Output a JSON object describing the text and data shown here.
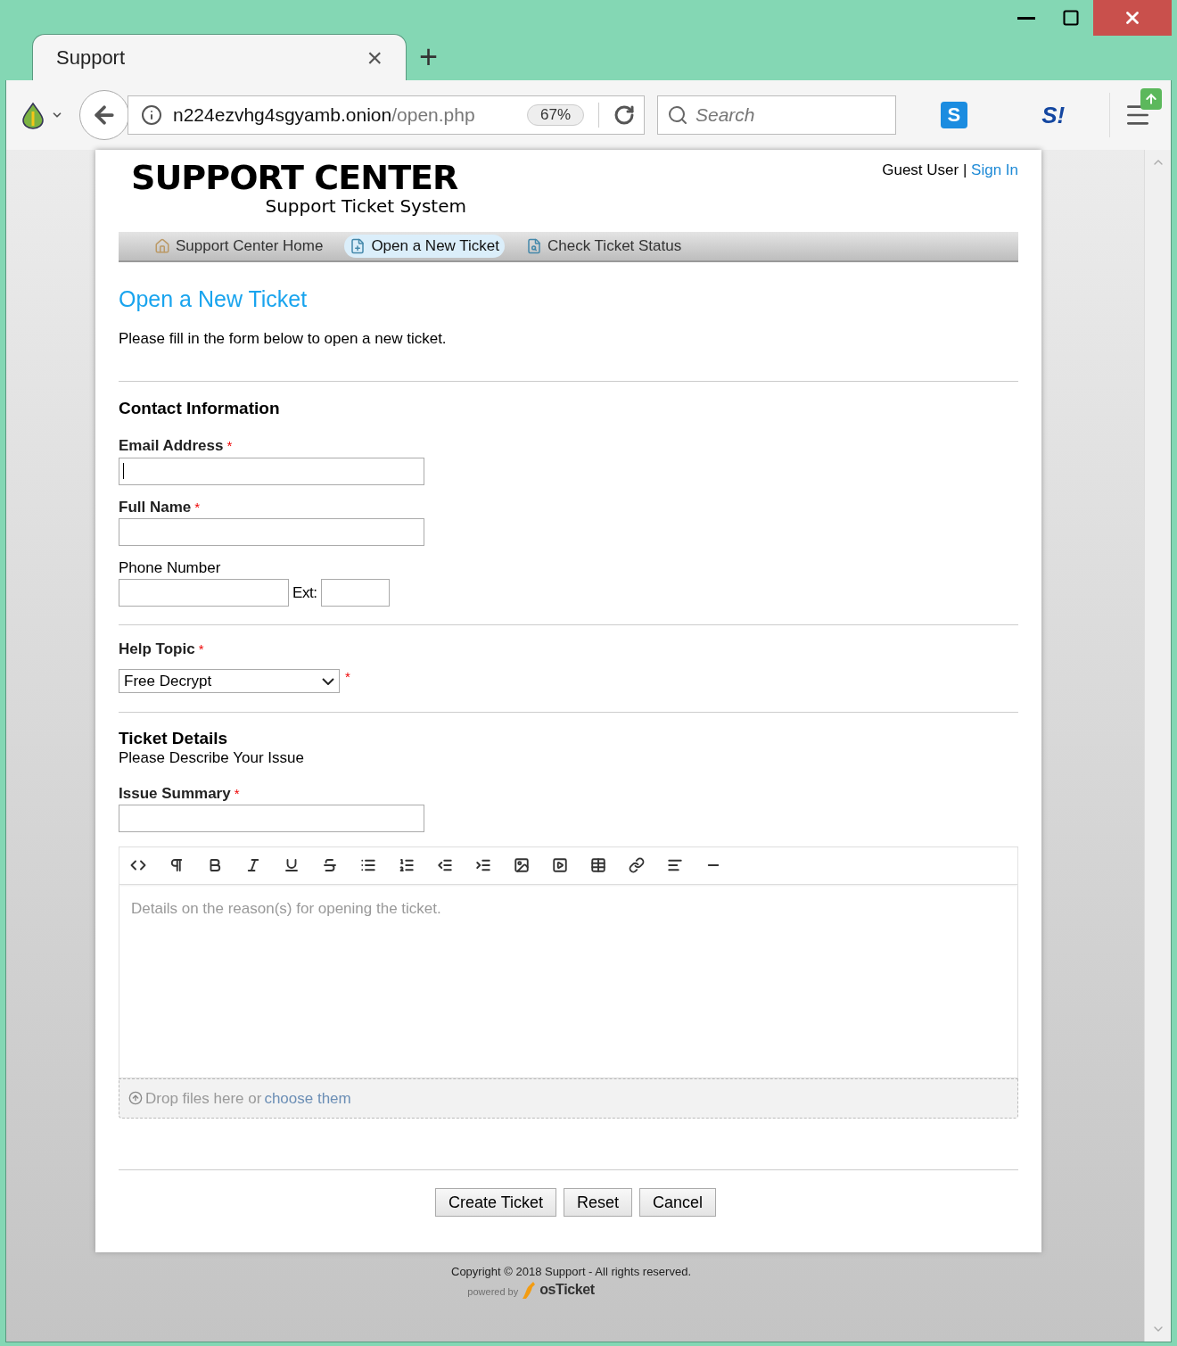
{
  "browser": {
    "tab": {
      "title": "Support",
      "close": "×"
    },
    "new_tab": "+",
    "url": {
      "host": "n224ezvhg4sgyamb.onion",
      "path": "/open.php"
    },
    "zoom": "67%",
    "search": {
      "placeholder": "Search"
    },
    "extension_icons": [
      "S",
      "S!"
    ]
  },
  "header": {
    "logo_title": "SUPPORT CENTER",
    "logo_subtitle": "Support Ticket System",
    "user": "Guest User |",
    "sign_in": "Sign In"
  },
  "nav": [
    {
      "label": "Support Center Home",
      "kind": "home",
      "selected": false
    },
    {
      "label": "Open a New Ticket",
      "kind": "new",
      "selected": true
    },
    {
      "label": "Check Ticket Status",
      "kind": "status",
      "selected": false
    }
  ],
  "page": {
    "title": "Open a New Ticket",
    "intro": "Please fill in the form below to open a new ticket."
  },
  "contact": {
    "heading": "Contact Information",
    "email": {
      "label": "Email Address",
      "required_mark": "*",
      "focused": true
    },
    "name": {
      "label": "Full Name",
      "required_mark": "*",
      "focused": false
    },
    "phone": {
      "label": "Phone Number",
      "ext_label": "Ext:"
    }
  },
  "help_topic": {
    "label": "Help Topic",
    "value": "Free Decrypt",
    "required_mark": "*"
  },
  "details": {
    "heading": "Ticket Details",
    "subheading": "Please Describe Your Issue",
    "summary": {
      "label": "Issue Summary",
      "required_mark": "*"
    },
    "editor": {
      "placeholder": "Details on the reason(s) for opening the ticket."
    },
    "dropzone": {
      "text": "Drop files here or",
      "link": "choose them"
    }
  },
  "buttons": [
    "Create Ticket",
    "Reset",
    "Cancel"
  ],
  "footer": {
    "copyright": "Copyright © 2018 Support - All rights reserved.",
    "powered_by": "powered by",
    "brand": "osTicket"
  }
}
